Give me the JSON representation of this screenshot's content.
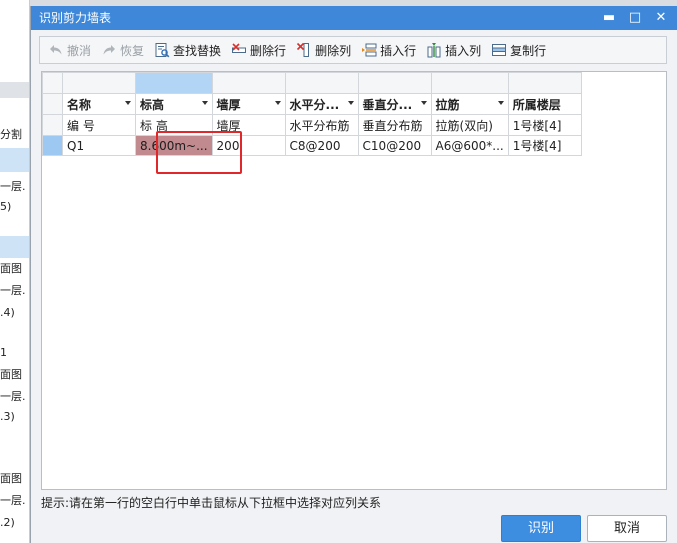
{
  "background_app": {
    "left_fragments": [
      "分割",
      "一层.",
      "5)",
      "面图",
      "一层.",
      ".4)",
      "1",
      "面图",
      "一层.",
      ".3)",
      "面图",
      "一层.",
      ".2)"
    ]
  },
  "dialog": {
    "title": "识别剪力墙表",
    "window_buttons": {
      "minimize": "▬",
      "maximize": "□",
      "close": "✕"
    },
    "toolbar": [
      {
        "label": "撤消",
        "icon": "undo-icon",
        "enabled": false
      },
      {
        "label": "恢复",
        "icon": "redo-icon",
        "enabled": false
      },
      {
        "label": "查找替换",
        "icon": "find-replace-icon",
        "enabled": true
      },
      {
        "label": "删除行",
        "icon": "delete-row-icon",
        "enabled": true
      },
      {
        "label": "删除列",
        "icon": "delete-column-icon",
        "enabled": true
      },
      {
        "label": "插入行",
        "icon": "insert-row-icon",
        "enabled": true
      },
      {
        "label": "插入列",
        "icon": "insert-column-icon",
        "enabled": true
      },
      {
        "label": "复制行",
        "icon": "copy-row-icon",
        "enabled": true
      }
    ],
    "grid": {
      "columns": [
        "名称",
        "标高",
        "墙厚",
        "水平分...",
        "垂直分...",
        "拉筋",
        "所属楼层"
      ],
      "column_has_dropdown": [
        true,
        true,
        true,
        true,
        true,
        true,
        false
      ],
      "rows": [
        [
          "编  号",
          "标  高",
          "墙厚",
          "水平分布筋",
          "垂直分布筋",
          "拉筋(双向)",
          "1号楼[4]"
        ],
        [
          "Q1",
          "8.600m~...",
          "200",
          "C8@200",
          "C10@200",
          "A6@600*...",
          "1号楼[4]"
        ]
      ],
      "selected_cell": {
        "row": 1,
        "col": 1
      }
    },
    "hint": "提示:请在第一行的空白行中单击鼠标从下拉框中选择对应列关系",
    "buttons": {
      "ok": "识别",
      "cancel": "取消"
    },
    "colors": {
      "titlebar": "#3f88d9",
      "primary_button": "#3d8ee0",
      "selected_cell": "#c08a8e",
      "highlight_border": "#e0282a"
    }
  }
}
